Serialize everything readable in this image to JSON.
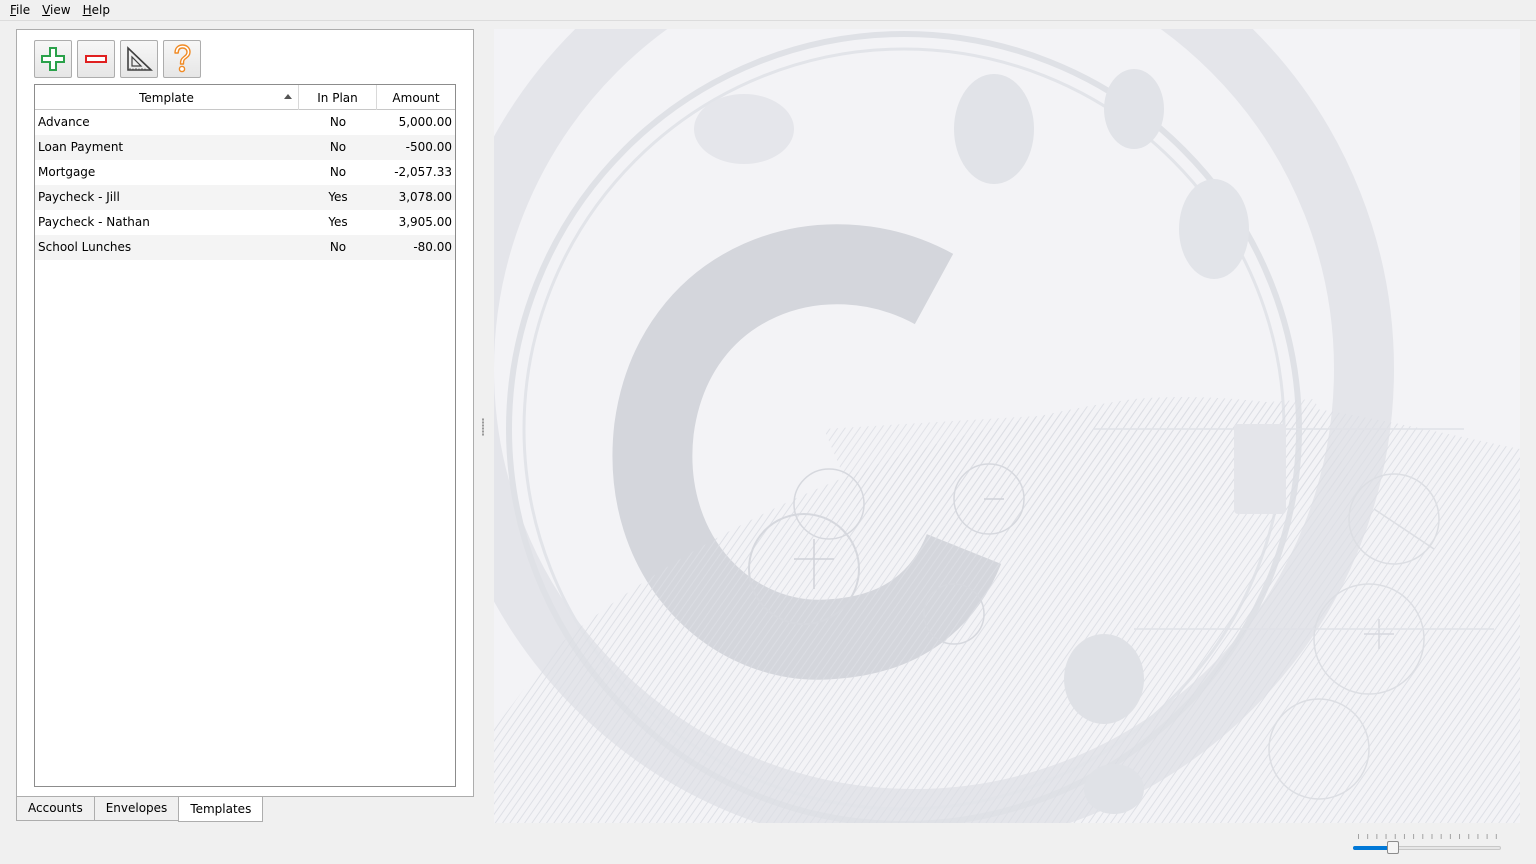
{
  "menu": {
    "items": [
      {
        "label": "File",
        "accel": "F",
        "rest": "ile"
      },
      {
        "label": "View",
        "accel": "V",
        "rest": "iew"
      },
      {
        "label": "Help",
        "accel": "H",
        "rest": "elp"
      }
    ]
  },
  "toolbar": {
    "buttons": [
      {
        "name": "add",
        "icon": "plus-icon",
        "color": "#2aa14a"
      },
      {
        "name": "remove",
        "icon": "minus-icon",
        "color": "#e02020"
      },
      {
        "name": "edit",
        "icon": "set-square-icon",
        "color": "#404040"
      },
      {
        "name": "help",
        "icon": "question-icon",
        "color": "#f08a24"
      }
    ]
  },
  "table": {
    "headers": {
      "template": "Template",
      "in_plan": "In Plan",
      "amount": "Amount"
    },
    "sort_column": "Template",
    "sort_direction": "ascending",
    "rows": [
      {
        "template": "Advance",
        "in_plan": "No",
        "amount": "5,000.00"
      },
      {
        "template": "Loan Payment",
        "in_plan": "No",
        "amount": "-500.00"
      },
      {
        "template": "Mortgage",
        "in_plan": "No",
        "amount": "-2,057.33"
      },
      {
        "template": "Paycheck - Jill",
        "in_plan": "Yes",
        "amount": "3,078.00"
      },
      {
        "template": "Paycheck - Nathan",
        "in_plan": "Yes",
        "amount": "3,905.00"
      },
      {
        "template": "School Lunches",
        "in_plan": "No",
        "amount": "-80.00"
      }
    ]
  },
  "tabs": {
    "items": [
      {
        "label": "Accounts",
        "active": false
      },
      {
        "label": "Envelopes",
        "active": false
      },
      {
        "label": "Templates",
        "active": true
      }
    ]
  },
  "zoom": {
    "level_fraction": 0.27
  },
  "colors": {
    "accent": "#0078d7",
    "watermark": "#d9dbe0",
    "background": "#f0f0f0"
  }
}
